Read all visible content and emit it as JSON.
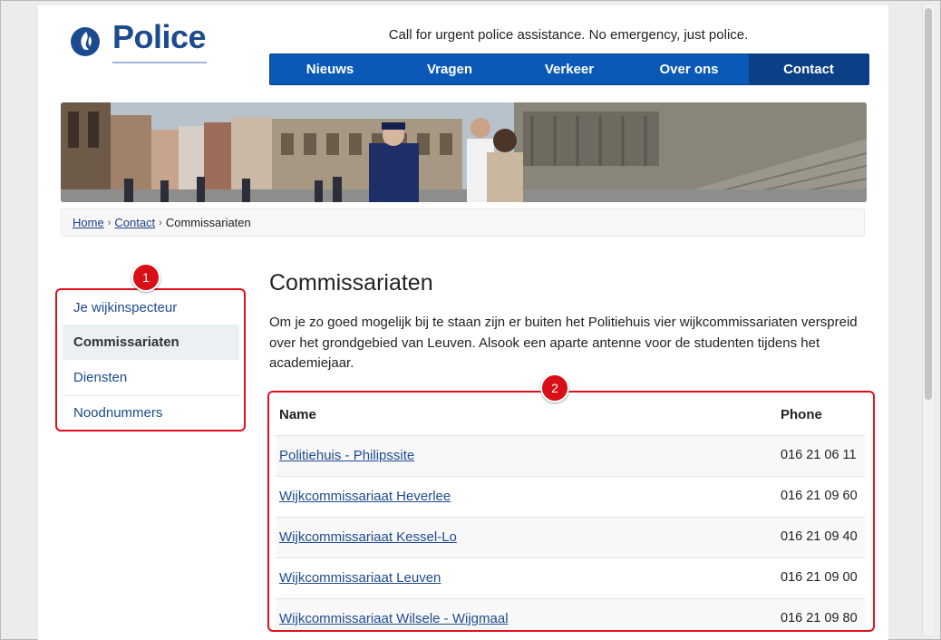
{
  "header": {
    "logo_text": "Police",
    "tagline": "Call for urgent police assistance. No emergency, just police.",
    "nav": [
      "Nieuws",
      "Vragen",
      "Verkeer",
      "Over ons",
      "Contact"
    ],
    "active_nav": "Contact"
  },
  "breadcrumb": {
    "home": "Home",
    "contact": "Contact",
    "current": "Commissariaten"
  },
  "sidebar": {
    "items": [
      {
        "label": "Je wijkinspecteur"
      },
      {
        "label": "Commissariaten",
        "active": true
      },
      {
        "label": "Diensten"
      },
      {
        "label": "Noodnummers"
      }
    ]
  },
  "callouts": [
    "1",
    "2"
  ],
  "main": {
    "title": "Commissariaten",
    "intro": "Om je zo goed mogelijk bij te staan zijn er buiten het Politiehuis vier wijkcommissariaten verspreid over het grondgebied van Leuven. Alsook een aparte antenne voor de studenten tijdens het academiejaar.",
    "table": {
      "headers": {
        "name": "Name",
        "phone": "Phone"
      },
      "rows": [
        {
          "name": "Politiehuis - Philipssite",
          "phone": "016 21 06 11"
        },
        {
          "name": "Wijkcommissariaat Heverlee",
          "phone": "016 21 09 60"
        },
        {
          "name": "Wijkcommissariaat Kessel-Lo",
          "phone": "016 21 09 40"
        },
        {
          "name": "Wijkcommissariaat Leuven",
          "phone": "016 21 09 00"
        },
        {
          "name": "Wijkcommissariaat Wilsele - Wijgmaal",
          "phone": "016 21 09 80"
        }
      ]
    }
  },
  "colors": {
    "nav_blue": "#0a59b6",
    "nav_active": "#0b3f86",
    "link_blue": "#1d4b8f",
    "callout_red": "#d90f17"
  }
}
